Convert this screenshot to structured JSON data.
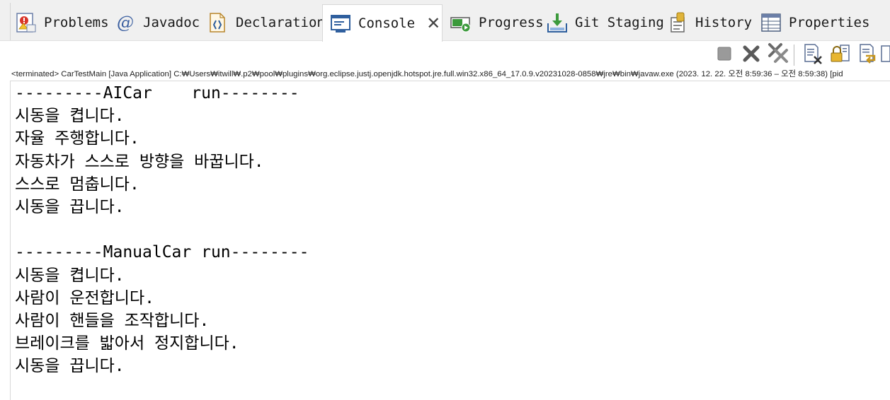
{
  "tabs": [
    {
      "label": "Problems",
      "icon": "problems-icon"
    },
    {
      "label": "Javadoc",
      "icon": "javadoc-icon"
    },
    {
      "label": "Declaration",
      "icon": "declaration-icon"
    },
    {
      "label": "Console",
      "icon": "console-icon",
      "active": true
    },
    {
      "label": "Progress",
      "icon": "progress-icon"
    },
    {
      "label": "Git Staging",
      "icon": "git-staging-icon"
    },
    {
      "label": "History",
      "icon": "history-icon"
    },
    {
      "label": "Properties",
      "icon": "properties-icon"
    }
  ],
  "javadoc_symbol": "@",
  "toolbar": {
    "buttons": [
      "terminate-icon",
      "remove-launch-icon",
      "remove-all-terminated-icon",
      "clear-console-icon",
      "scroll-lock-icon",
      "word-wrap-icon"
    ]
  },
  "status_line": "<terminated> CarTestMain [Java Application] C:₩Users₩itwill₩.p2₩pool₩plugins₩org.eclipse.justj.openjdk.hotspot.jre.full.win32.x86_64_17.0.9.v20231028-0858₩jre₩bin₩javaw.exe  (2023. 12. 22. 오전 8:59:36 – 오전 8:59:38) [pid",
  "console_output": [
    "---------AICar    run--------",
    "시동을 켭니다.",
    "자율 주행합니다.",
    "자동차가 스스로 방향을 바꿉니다.",
    "스스로 멈춥니다.",
    "시동을 끕니다.",
    "",
    "---------ManualCar run--------",
    "시동을 켭니다.",
    "사람이 운전합니다.",
    "사람이 핸들을 조작합니다.",
    "브레이크를 밟아서 정지합니다.",
    "시동을 끕니다."
  ],
  "colors": {
    "tabbar_bg": "#f0f0f0",
    "accent_blue": "#2f5f9e",
    "console_bg": "#ffffff"
  }
}
